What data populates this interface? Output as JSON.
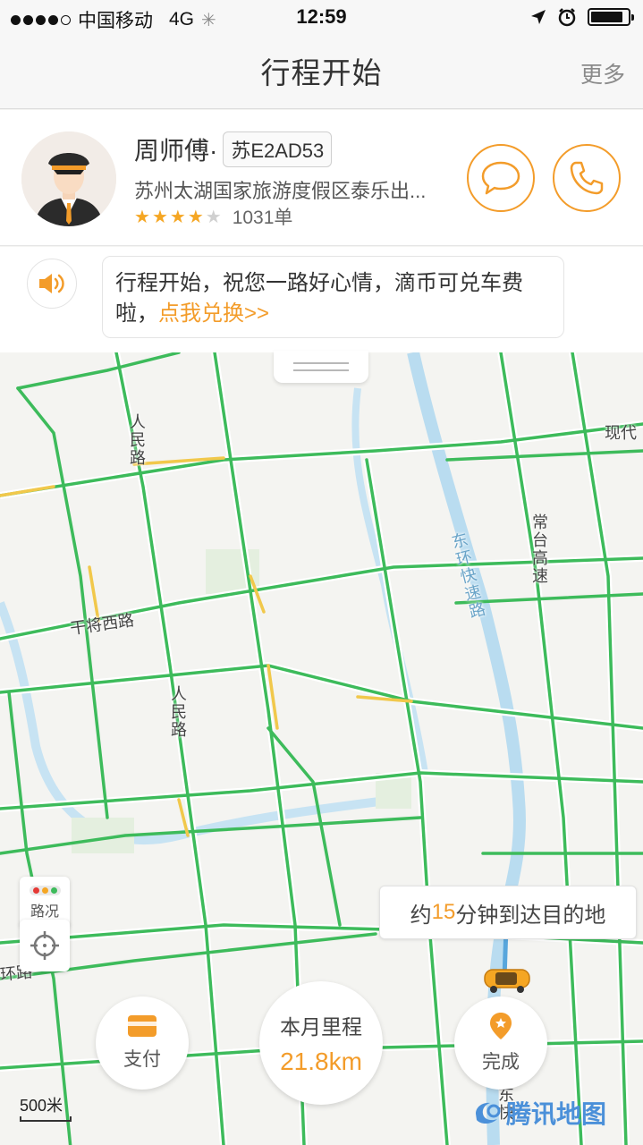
{
  "status_bar": {
    "carrier": "中国移动",
    "network": "4G",
    "time": "12:59",
    "signal_bars_filled": 4,
    "signal_bars_total": 5
  },
  "nav": {
    "title": "行程开始",
    "more_label": "更多"
  },
  "driver": {
    "name": "周师傅·",
    "plate": "苏E2AD53",
    "address": "苏州太湖国家旅游度假区泰乐出...",
    "rating_stars": 4,
    "rating_max": 5,
    "orders": "1031单",
    "message_icon": "chat-bubble-icon",
    "phone_icon": "phone-icon"
  },
  "announcement": {
    "speaker_icon": "speaker-icon",
    "text": "行程开始，祝您一路好心情，滴币可兑车费啦，",
    "link_text": "点我兑换>>"
  },
  "map": {
    "road_labels": {
      "renmin_top": "人民路",
      "renmin_mid": "人民路",
      "ganjiang": "干将西路",
      "changtai": "常台高速",
      "dongkuai": "东环快速路",
      "xiandai": "现代",
      "huanlu": "环路",
      "dong_bottom": "东快"
    },
    "traffic_label": "路况",
    "eta_prefix": "约",
    "eta_minutes": "15",
    "eta_suffix": "分钟到达目的地",
    "scale_label": "500米",
    "watermark": "腾讯地图"
  },
  "bottom_actions": {
    "pay_label": "支付",
    "mileage_title": "本月里程",
    "mileage_value": "21.8km",
    "finish_label": "完成"
  },
  "colors": {
    "accent": "#f39c2a",
    "road_green": "#3dbb5b",
    "road_yellow": "#f1c84b",
    "river": "#b9dcf0"
  }
}
